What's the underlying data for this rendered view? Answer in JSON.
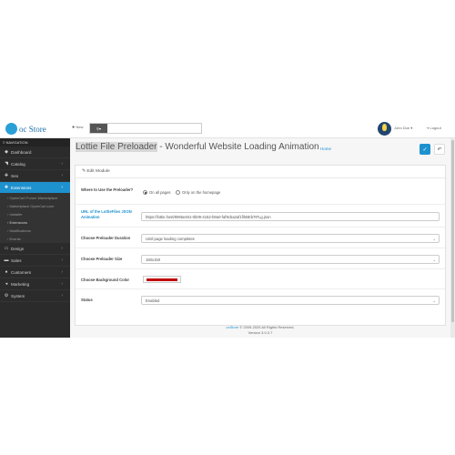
{
  "header": {
    "logo_text": "oc Store",
    "new_menu_label": "New",
    "search_type_label": "▾",
    "search_placeholder": "",
    "user_name": "John Doe ▾",
    "logout_label": "Logout"
  },
  "sidebar": {
    "title": "NAVIGATION",
    "items_top": [
      {
        "icon": "dashboard-icon",
        "glyph": "◆",
        "label": "Dashboard",
        "chevron": ""
      },
      {
        "icon": "tag-icon",
        "glyph": "◥",
        "label": "Catalog",
        "chevron": "›"
      },
      {
        "icon": "puzzle-icon",
        "glyph": "✚",
        "label": "Seo",
        "chevron": "›"
      },
      {
        "icon": "extensions-icon",
        "glyph": "✚",
        "label": "Extensions",
        "chevron": "›"
      }
    ],
    "sub_items": [
      "OpenCart Forum Marketplace",
      "Marketplace OpenCart.com",
      "Installer",
      "Extensions",
      "Modifications",
      "Events"
    ],
    "items_bottom": [
      {
        "icon": "design-icon",
        "glyph": "▭",
        "label": "Design",
        "chevron": "›"
      },
      {
        "icon": "sales-icon",
        "glyph": "▬",
        "label": "Sales",
        "chevron": "›"
      },
      {
        "icon": "customers-icon",
        "glyph": "●",
        "label": "Customers",
        "chevron": "›"
      },
      {
        "icon": "marketing-icon",
        "glyph": "◂",
        "label": "Marketing",
        "chevron": "›"
      },
      {
        "icon": "system-icon",
        "glyph": "⚙",
        "label": "System",
        "chevron": "›"
      }
    ]
  },
  "page": {
    "title_highlight": "Lottie File Preloader",
    "title_rest": " - Wonderful Website Loading Animation",
    "breadcrumb_home": "Home",
    "save_glyph": "✓",
    "back_glyph": "↶"
  },
  "panel": {
    "heading": "✎ Edit Module",
    "use_label": "Where to Use the Preloader?",
    "radio_all": "On all pages",
    "radio_home": "Only on the homepage",
    "url_label": "URL of the LottieFiles JSON Animation",
    "url_value": "https://lottie.host/8065e461-0b09-4152-b9a0-faf9cba2af1f/kBEb7tFLg.json",
    "duration_label": "Choose Preloader Duration",
    "duration_value": "Until page loading completes",
    "size_label": "Choose Preloader Size",
    "size_value": "150x150",
    "bg_label": "Choose Background Color",
    "bg_color": "#c00000",
    "status_label": "Status",
    "status_value": "Enabled"
  },
  "footer": {
    "brand": "ocStore",
    "copyright": " © 2009-2025 All Rights Reserved.",
    "version": "Version 3.0.3.7"
  },
  "colors": {
    "accent": "#1e91cf",
    "sidebar_bg": "#2b2b2b"
  }
}
